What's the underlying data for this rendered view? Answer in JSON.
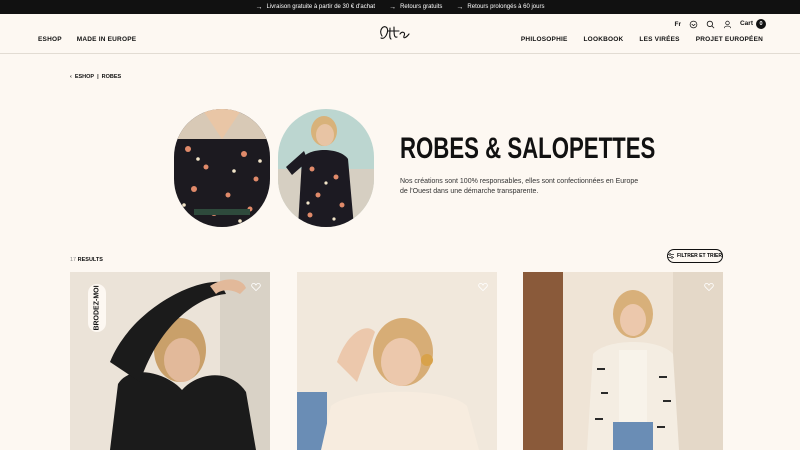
{
  "topbar": {
    "promos": [
      "Livraison gratuite à partir de 30 € d'achat",
      "Retours gratuits",
      "Retours prolongés à 60 jours"
    ]
  },
  "header": {
    "nav_left": [
      "ESHOP",
      "MADE IN EUROPE"
    ],
    "nav_right": [
      "PHILOSOPHIE",
      "LOOKBOOK",
      "LES VIRÉES",
      "PROJET EUROPÉEN"
    ],
    "language": "Fr",
    "cart_label": "Cart",
    "cart_count": "0"
  },
  "breadcrumb": [
    "ESHOP",
    "ROBES"
  ],
  "hero": {
    "title": "ROBES & SALOPETTES",
    "description": "Nos créations sont 100% responsables, elles sont confectionnées en Europe de l'Ouest dans une démarche transparente."
  },
  "results": {
    "count": "17",
    "label": "RESULTS"
  },
  "filter_label": "FILTRER ET TRIER",
  "products": [
    {
      "badge": "BRODEZ-MOI"
    }
  ],
  "colors": {
    "background": "#fdf8f2",
    "text": "#111111",
    "topbar": "#111111"
  }
}
